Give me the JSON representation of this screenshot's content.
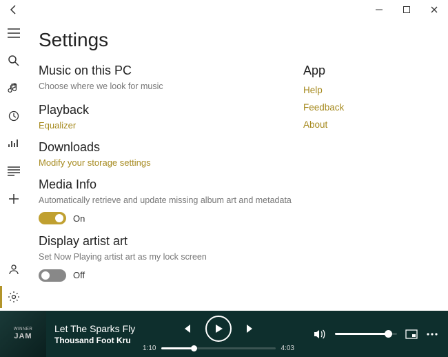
{
  "page_title": "Settings",
  "left": {
    "music": {
      "heading": "Music on this PC",
      "desc": "Choose where we look for music"
    },
    "playback": {
      "heading": "Playback",
      "link": "Equalizer"
    },
    "downloads": {
      "heading": "Downloads",
      "link": "Modify your storage settings"
    },
    "mediainfo": {
      "heading": "Media Info",
      "desc": "Automatically retrieve and update missing album art and metadata",
      "toggle_state": "On"
    },
    "artistart": {
      "heading": "Display artist art",
      "desc": "Set Now Playing artist art as my lock screen",
      "toggle_state": "Off"
    }
  },
  "right": {
    "heading": "App",
    "links": {
      "help": "Help",
      "feedback": "Feedback",
      "about": "About"
    }
  },
  "player": {
    "track_title": "Let The Sparks Fly",
    "artist": "Thousand Foot Kru",
    "elapsed": "1:10",
    "total": "4:03",
    "album_text1": "WINNER",
    "album_text2": "JAM"
  }
}
